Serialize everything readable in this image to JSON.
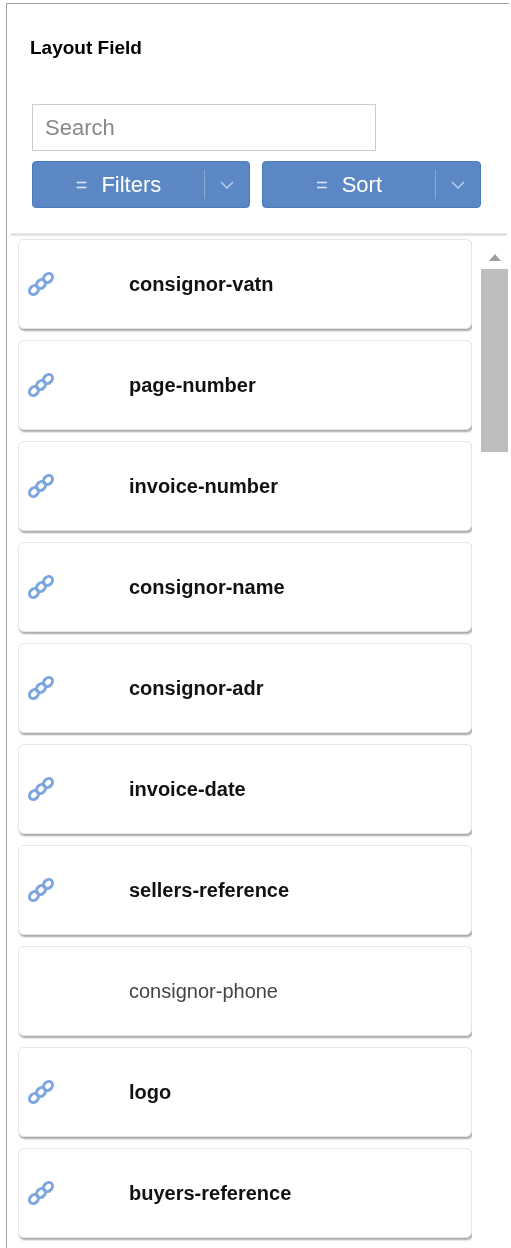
{
  "panel": {
    "title": "Layout Field"
  },
  "search": {
    "placeholder": "Search"
  },
  "buttons": [
    {
      "icon": "=",
      "label": "Filters"
    },
    {
      "icon": "=",
      "label": "Sort"
    }
  ],
  "fields": [
    {
      "name": "consignor-vatn",
      "linked": true
    },
    {
      "name": "page-number",
      "linked": true
    },
    {
      "name": "invoice-number",
      "linked": true
    },
    {
      "name": "consignor-name",
      "linked": true
    },
    {
      "name": "consignor-adr",
      "linked": true
    },
    {
      "name": "invoice-date",
      "linked": true
    },
    {
      "name": "sellers-reference",
      "linked": true
    },
    {
      "name": "consignor-phone",
      "linked": false
    },
    {
      "name": "logo",
      "linked": true
    },
    {
      "name": "buyers-reference",
      "linked": true
    }
  ]
}
